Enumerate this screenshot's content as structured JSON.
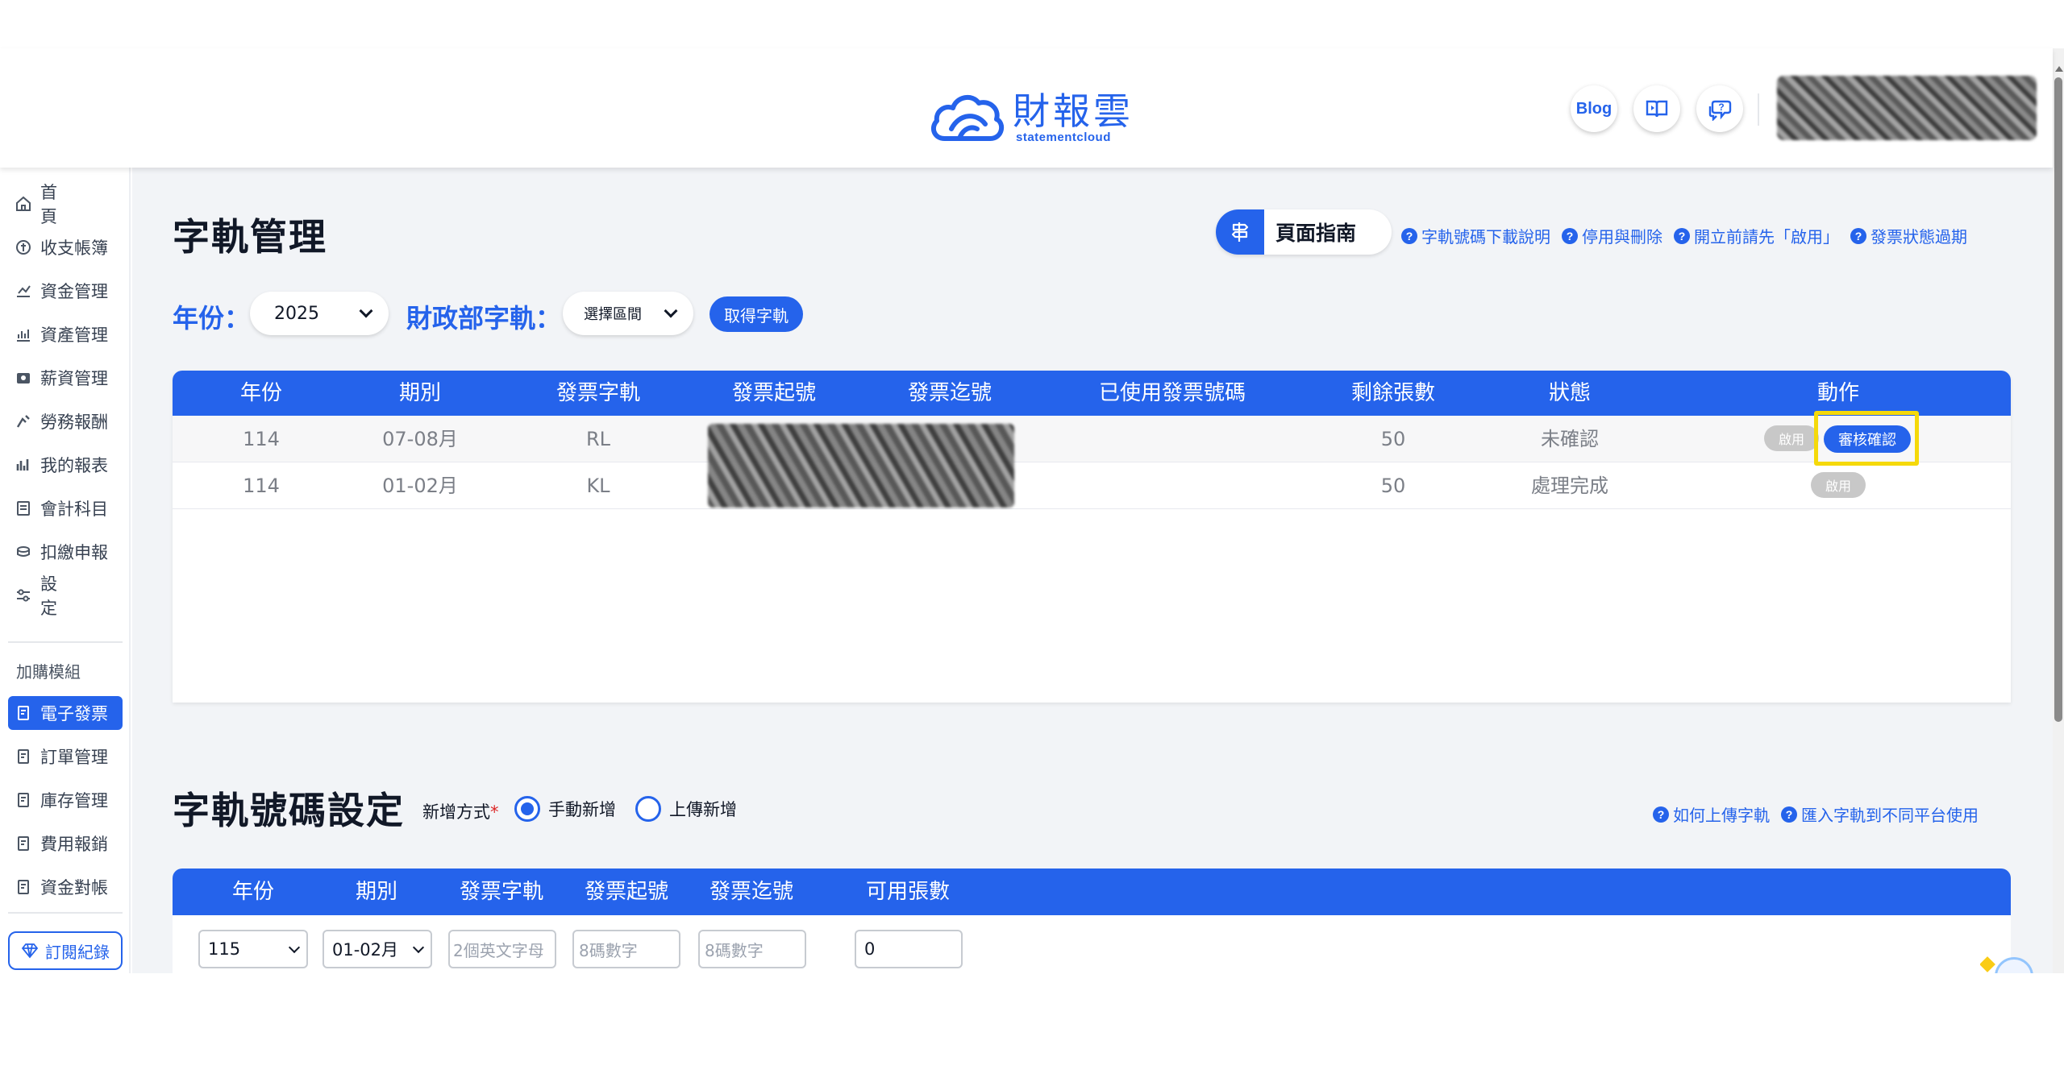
{
  "header": {
    "logo_cn": "財報雲",
    "logo_en": "statementcloud",
    "blog_label": "Blog",
    "icons": [
      "video-book-icon",
      "chat-question-icon"
    ],
    "accent": "#2563eb"
  },
  "sidebar": {
    "items": [
      {
        "label": "首 頁",
        "icon": "home-icon"
      },
      {
        "label": "收支帳簿",
        "icon": "ledger-icon"
      },
      {
        "label": "資金管理",
        "icon": "funds-icon"
      },
      {
        "label": "資產管理",
        "icon": "asset-chart-icon"
      },
      {
        "label": "薪資管理",
        "icon": "salary-icon"
      },
      {
        "label": "勞務報酬",
        "icon": "labor-icon"
      },
      {
        "label": "我的報表",
        "icon": "report-icon"
      },
      {
        "label": "會計科目",
        "icon": "account-icon"
      },
      {
        "label": "扣繳申報",
        "icon": "withholding-icon"
      },
      {
        "label": "設 定",
        "icon": "settings-icon"
      }
    ],
    "group_label": "加購模組",
    "modules": [
      {
        "label": "電子發票",
        "active": true
      },
      {
        "label": "訂單管理",
        "active": false
      },
      {
        "label": "庫存管理",
        "active": false
      },
      {
        "label": "費用報銷",
        "active": false
      },
      {
        "label": "資金對帳",
        "active": false
      }
    ],
    "subscription_label": "訂閱紀錄"
  },
  "main": {
    "title": "字軌管理",
    "guide_label": "頁面指南",
    "help_links": [
      "字軌號碼下載說明",
      "停用與刪除",
      "開立前請先「啟用」",
      "發票狀態過期"
    ],
    "year_label": "年份：",
    "year_value": "2025",
    "mof_label": "財政部字軌：",
    "period_select": "選擇區間",
    "fetch_button": "取得字軌",
    "table": {
      "headers": [
        "年份",
        "期別",
        "發票字軌",
        "發票起號",
        "發票迄號",
        "已使用發票號碼",
        "剩餘張數",
        "狀態",
        "動作"
      ],
      "rows": [
        {
          "year": "114",
          "period": "07-08月",
          "track": "RL",
          "remaining": "50",
          "status": "未確認",
          "actions": [
            "啟用",
            "審核確認"
          ]
        },
        {
          "year": "114",
          "period": "01-02月",
          "track": "KL",
          "remaining": "50",
          "status": "處理完成",
          "actions": [
            "啟用"
          ]
        }
      ]
    }
  },
  "section2": {
    "title": "字軌號碼設定",
    "add_mode_label": "新增方式",
    "required_mark": "*",
    "radio_manual": "手動新增",
    "radio_upload": "上傳新增",
    "help_links": [
      "如何上傳字軌",
      "匯入字軌到不同平台使用"
    ],
    "headers": [
      "年份",
      "期別",
      "發票字軌",
      "發票起號",
      "發票迄號",
      "可用張數"
    ],
    "inputs": {
      "year": "115",
      "period": "01-02月",
      "track_placeholder": "2個英文字母",
      "start_placeholder": "8碼數字",
      "end_placeholder": "8碼數字",
      "count": "0"
    }
  }
}
